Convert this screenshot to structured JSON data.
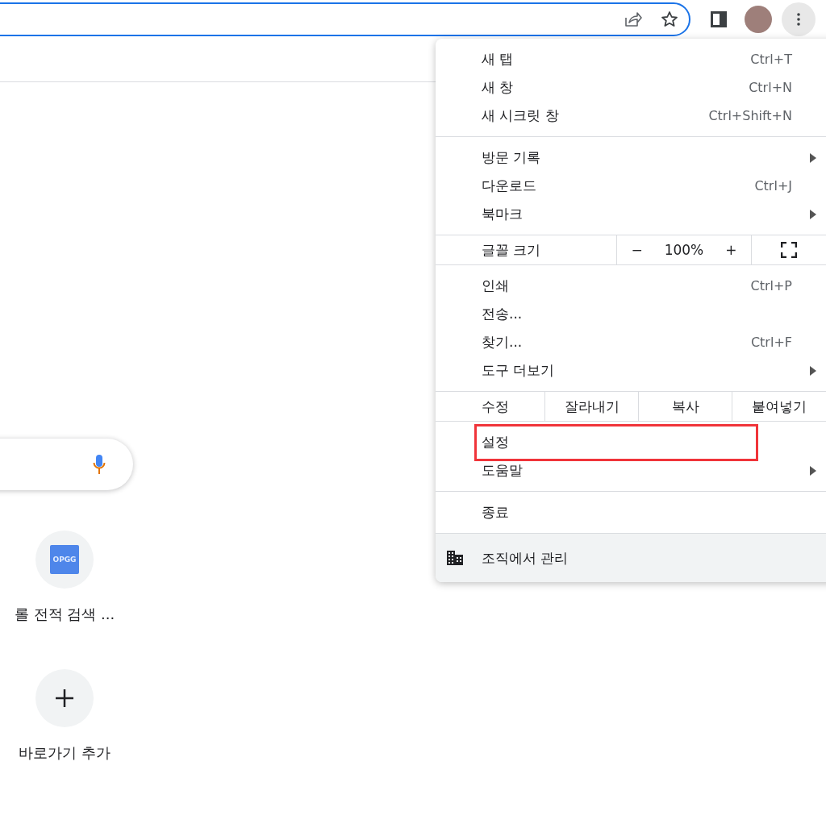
{
  "shortcuts": [
    {
      "kind": "site",
      "logo": "OPGG",
      "label": "롤 전적 검색 ..."
    },
    {
      "kind": "add",
      "label": "바로가기 추가"
    }
  ],
  "menu": {
    "sections": [
      [
        {
          "kind": "item",
          "label": "새 탭",
          "shortcut": "Ctrl+T",
          "submenu": false,
          "highlighted": false
        },
        {
          "kind": "item",
          "label": "새 창",
          "shortcut": "Ctrl+N",
          "submenu": false,
          "highlighted": false
        },
        {
          "kind": "item",
          "label": "새 시크릿 창",
          "shortcut": "Ctrl+Shift+N",
          "submenu": false,
          "highlighted": false
        }
      ],
      [
        {
          "kind": "item",
          "label": "방문 기록",
          "submenu": true,
          "highlighted": false
        },
        {
          "kind": "item",
          "label": "다운로드",
          "shortcut": "Ctrl+J",
          "submenu": false,
          "highlighted": false
        },
        {
          "kind": "item",
          "label": "북마크",
          "submenu": true,
          "highlighted": false
        }
      ],
      [
        {
          "kind": "zoom",
          "label": "글꼴 크기",
          "minus": "−",
          "value": "100%",
          "plus": "+"
        }
      ],
      [
        {
          "kind": "item",
          "label": "인쇄",
          "shortcut": "Ctrl+P",
          "submenu": false,
          "highlighted": false
        },
        {
          "kind": "item",
          "label": "전송...",
          "submenu": false,
          "highlighted": false
        },
        {
          "kind": "item",
          "label": "찾기...",
          "shortcut": "Ctrl+F",
          "submenu": false,
          "highlighted": false
        },
        {
          "kind": "item",
          "label": "도구 더보기",
          "submenu": true,
          "highlighted": false
        }
      ],
      [
        {
          "kind": "edit",
          "label": "수정",
          "actions": [
            "잘라내기",
            "복사",
            "붙여넣기"
          ]
        }
      ],
      [
        {
          "kind": "item",
          "label": "설정",
          "submenu": false,
          "highlighted": true
        },
        {
          "kind": "item",
          "label": "도움말",
          "submenu": true,
          "highlighted": false
        }
      ],
      [
        {
          "kind": "item",
          "label": "종료",
          "submenu": false,
          "highlighted": false
        }
      ],
      [
        {
          "kind": "managed",
          "label": "조직에서 관리"
        }
      ]
    ]
  }
}
